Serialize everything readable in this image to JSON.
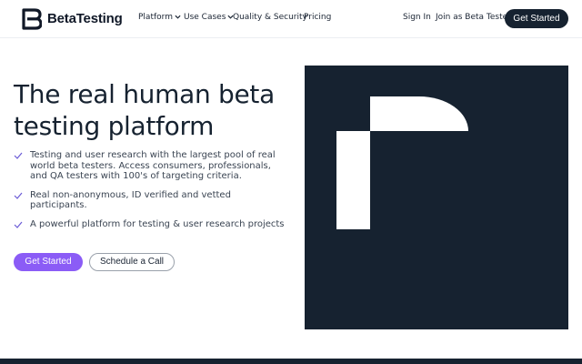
{
  "brand": {
    "name": "BetaTesting"
  },
  "nav": {
    "platform": "Platform",
    "use_cases": "Use Cases",
    "quality": "Quality & Security",
    "pricing": "Pricing",
    "sign_in": "Sign In",
    "join": "Join as Beta Tester",
    "get_started": "Get Started"
  },
  "hero": {
    "title": "The real human beta testing platform",
    "features": [
      "Testing and user research with the largest pool of real world beta testers. Access consumers, professionals, and QA testers with 100's of targeting criteria.",
      "Real non-anonymous, ID verified and vetted participants.",
      "A powerful platform for testing & user research projects"
    ],
    "primary_cta": "Get Started",
    "secondary_cta": "Schedule a Call"
  },
  "colors": {
    "dark_navy": "#162230",
    "accent_purple": "#8b5cf6"
  },
  "icons": {
    "logo": "betatesting-logo",
    "chevron": "chevron-down-icon",
    "check": "check-icon"
  }
}
